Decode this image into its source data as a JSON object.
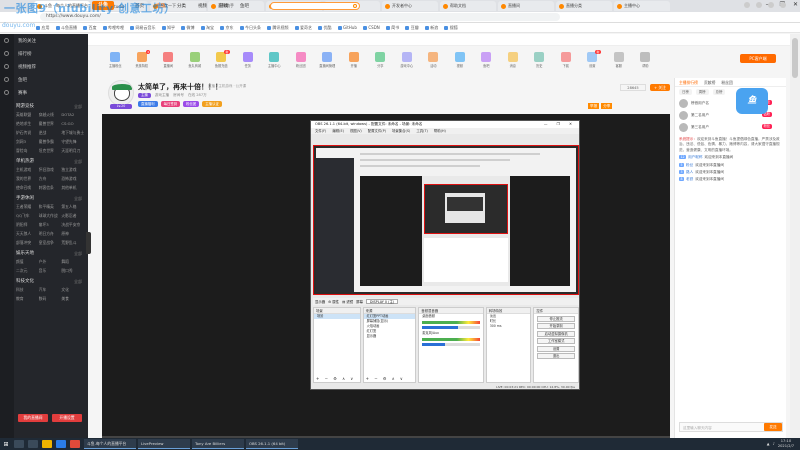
{
  "watermark": {
    "text": "一张图9（niubility 创意工坊）",
    "sub": "douyu.com"
  },
  "browser": {
    "tabs": [
      "斗鱼 - 每个人的直播平台",
      "OBS Studio",
      "百度一下",
      "直播助手",
      "新标签页",
      "设置",
      "开发者中心",
      "帮助文档",
      "直播间",
      "直播分类",
      "主播中心"
    ],
    "url": "https://www.douyu.com/",
    "window_controls": [
      "—",
      "❐",
      "✕"
    ],
    "bookmarks": [
      "应用",
      "斗鱼直播",
      "百度",
      "哔哩哔哩",
      "网易云音乐",
      "知乎",
      "微博",
      "淘宝",
      "京东",
      "今日头条",
      "腾讯视频",
      "爱奇艺",
      "优酷",
      "GitHub",
      "CSDN",
      "简书",
      "豆瓣",
      "新浪",
      "搜狐"
    ]
  },
  "site": {
    "logo": "斗鱼",
    "nav": [
      "首页",
      "直播",
      "分类",
      "视频",
      "游戏",
      "鱼吧"
    ],
    "active_nav": 1
  },
  "sidebar": {
    "top_items": [
      "我的关注",
      "排行榜",
      "视频推荐",
      "鱼吧",
      "赛事"
    ],
    "sections": [
      {
        "title": "网游竞技",
        "more": "全部",
        "items": [
          "英雄联盟",
          "穿越火线",
          "DOTA2",
          "绝地求生",
          "魔兽世界",
          "CS:GO",
          "炉石传说",
          "逆战",
          "地下城与勇士",
          "剑网3",
          "魔兽争霸",
          "守望先锋",
          "冒险岛",
          "坦克世界",
          "天涯明月刀"
        ]
      },
      {
        "title": "单机热游",
        "more": "全部",
        "items": [
          "主机游戏",
          "怀旧游戏",
          "独立游戏",
          "我的世界",
          "方舟",
          "恐怖游戏",
          "使命召唤",
          "刺客信条",
          "其他单机"
        ]
      },
      {
        "title": "手游休闲",
        "more": "全部",
        "items": [
          "王者荣耀",
          "和平精英",
          "第五人格",
          "QQ飞车",
          "球球大作战",
          "火影忍者",
          "阴阳师",
          "崩坏3",
          "决战平安京",
          "天天狼人",
          "明日方舟",
          "原神",
          "部落冲突",
          "皇室战争",
          "荒野乱斗"
        ]
      },
      {
        "title": "娱乐天地",
        "more": "全部",
        "items": [
          "颜值",
          "户外",
          "舞蹈",
          "二次元",
          "音乐",
          "脱口秀"
        ]
      },
      {
        "title": "科技文化",
        "more": "全部",
        "items": [
          "科技",
          "汽车",
          "文化",
          "教育",
          "数码",
          "美食"
        ]
      }
    ],
    "buttons": [
      "我的直播间",
      "开播设置"
    ]
  },
  "func_bar": {
    "items": [
      {
        "label": "主播粉丝",
        "badge": ""
      },
      {
        "label": "贵族特权",
        "badge": "4"
      },
      {
        "label": "直播间",
        "badge": ""
      },
      {
        "label": "鱼丸商城",
        "badge": ""
      },
      {
        "label": "鱼翅充值",
        "badge": "新"
      },
      {
        "label": "任务",
        "badge": ""
      },
      {
        "label": "主播中心",
        "badge": ""
      },
      {
        "label": "粉丝团",
        "badge": ""
      },
      {
        "label": "直播间管理",
        "badge": ""
      },
      {
        "label": "开播",
        "badge": ""
      },
      {
        "label": "分享",
        "badge": ""
      },
      {
        "label": "游戏中心",
        "badge": ""
      },
      {
        "label": "活动",
        "badge": ""
      },
      {
        "label": "视频",
        "badge": ""
      },
      {
        "label": "鱼吧",
        "badge": ""
      },
      {
        "label": "消息",
        "badge": ""
      },
      {
        "label": "历史",
        "badge": ""
      },
      {
        "label": "下载",
        "badge": ""
      },
      {
        "label": "设置",
        "badge": "新"
      },
      {
        "label": "客服",
        "badge": ""
      },
      {
        "label": "帮助",
        "badge": ""
      }
    ],
    "right_button": "PC客户端"
  },
  "room": {
    "title": "太简单了，再来十倍！！！",
    "tag": "直播 · 主机游戏 · 公开课",
    "meta": [
      "主播",
      "游戏主播",
      "房间号",
      "在线 287万"
    ],
    "badges": [
      "直播福利",
      "每日签到",
      "粉丝团",
      "主播认证"
    ],
    "level": "Lv.20",
    "follow_count": "28645",
    "follow_label": "+ 关注",
    "report": [
      "举报",
      "分享"
    ]
  },
  "obs": {
    "title": "OBS 26.1.1 (64-bit, windows) - 配置文件: 未命名 - 场景: 未命名",
    "menu": [
      "文件(F)",
      "编辑(E)",
      "视图(V)",
      "配置文件(P)",
      "场景集合(S)",
      "工具(T)",
      "帮助(H)"
    ],
    "scene_bar": [
      "显示器",
      "⚙ 属性",
      "▤ 滤镜",
      "屏幕",
      "DISPLAY 0 (主)"
    ],
    "docks": {
      "scenes": {
        "title": "场景",
        "rows": [
          "场景"
        ]
      },
      "sources": {
        "title": "来源",
        "rows": [
          "红灯笼PPT动画",
          "屏幕捕捉(显示)",
          "火焰动画",
          "红灯笼",
          "显示器"
        ]
      },
      "mixer": {
        "title": "音频混音器",
        "rows": [
          "桌面音频",
          "麦克风/Aux"
        ],
        "values": [
          0.62,
          0.4
        ]
      },
      "transitions": {
        "title": "转场特效",
        "rows": [
          "淡出",
          "时长",
          "300 ms"
        ]
      },
      "controls": {
        "title": "控件",
        "buttons": [
          "停止推流",
          "开始录制",
          "启动虚拟摄像机",
          "工作室模式",
          "设置",
          "退出"
        ]
      }
    },
    "status": "LIVE: 00:03:21   REC: 00:00:00   CPU: 12.8%, 30.00 fps"
  },
  "chat": {
    "tabs": [
      "主播排行榜",
      "贡献榜",
      "粉丝团"
    ],
    "rank_tabs": [
      "日榜",
      "周榜",
      "总榜"
    ],
    "ranks": [
      {
        "name": "榜首用户名",
        "badge": "粉丝"
      },
      {
        "name": "第二名用户",
        "badge": "钻粉"
      },
      {
        "name": "第三名用户",
        "badge": "粉丝"
      }
    ],
    "notice_prefix": "系统提示：",
    "notice": "欢迎来到斗鱼直播！斗鱼提倡绿色直播，严禁涉及政治、违法、低俗、色情、暴力、赌博等内容，请大家遵守直播规范，营造健康、文明的直播环境。",
    "messages": [
      {
        "level": "12",
        "user": "用户昵称",
        "text": "欢迎来到本直播间"
      },
      {
        "level": "5",
        "user": "粉丝",
        "text": "欢迎来到本直播间"
      },
      {
        "level": "3",
        "user": "路人",
        "text": "欢迎来到本直播间"
      },
      {
        "level": "8",
        "user": "老铁",
        "text": "欢迎来到本直播间"
      }
    ],
    "input_placeholder": "这里输入聊天内容",
    "send": "发送"
  },
  "taskbar": {
    "apps": [
      "斗鱼-每个人的直播平台",
      "LivePreview",
      "Tony Are Billiers",
      "OBS 26.1.1 (64 bit)"
    ],
    "time": "17:10",
    "date": "2021/2/7"
  }
}
